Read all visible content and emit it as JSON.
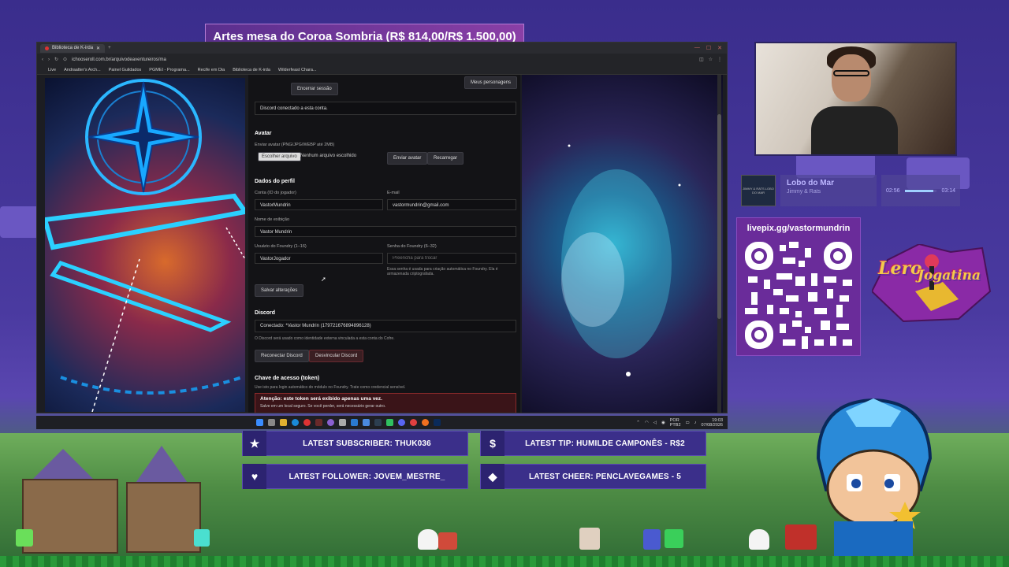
{
  "stream_title": "Artes mesa do Coroa Sombria (R$ 814,00/R$ 1.500,00)",
  "browser": {
    "tab_title": "Biblioteca de K-irda",
    "url": "ichooseroll.com.br/arquivodeaventureiros/ma",
    "bookmarks": [
      "Live",
      "Andraatter's Arch...",
      "Painel Guildados",
      "PGMEI - Programa...",
      "Recife em Dia",
      "Biblioteca de K-irda",
      "Wilderfeast Chara..."
    ]
  },
  "panel": {
    "my_characters_button": "Meus personagens",
    "logout_button": "Encerrar sessão",
    "discord_notice": "Discord conectado a esta conta.",
    "avatar": {
      "heading": "Avatar",
      "hint": "Enviar avatar (PNG/JPG/WEBP até 2MB)",
      "choose_file_button": "Escolher arquivo",
      "no_file_text": "Nenhum arquivo escolhido",
      "send_button": "Enviar avatar",
      "reload_button": "Recarregar"
    },
    "profile": {
      "heading": "Dados do perfil",
      "account_label": "Conta (ID do jogador)",
      "account_value": "VastorMundrin",
      "email_label": "E-mail",
      "email_value": "vastormundrin@gmail.com",
      "display_name_label": "Nome de exibição",
      "display_name_value": "Vastor Mundrin",
      "foundry_user_label": "Usuário do Foundry (1–16)",
      "foundry_user_value": "VastorJogador",
      "foundry_password_label": "Senha do Foundry (6–32)",
      "foundry_password_placeholder": "Preencha para trocar",
      "foundry_password_help": "Essa senha é usada para criação automática no Foundry. Ela é armazenada criptografada.",
      "save_button": "Salvar alterações"
    },
    "discord": {
      "heading": "Discord",
      "connected_text": "Conectado: *Vastor Mundrin (179721676894896128)",
      "help": "O Discord será usado como identidade externa vinculada a esta conta do Cofre.",
      "reconnect_button": "Reconectar Discord",
      "unlink_button": "Desvincular Discord"
    },
    "token": {
      "heading": "Chave de acesso (token)",
      "help": "Use isto para login automático do módulo no Foundry. Trate como credencial sensível.",
      "warning_title": "Atenção: este token será exibido apenas uma vez.",
      "warning_text": "Salve em um local seguro. Se você perder, será necessário gerar outro."
    }
  },
  "taskbar": {
    "lang": "POR",
    "lang_sub": "PTB2",
    "time": "19:03",
    "date": "07/08/2026"
  },
  "music": {
    "cover_text": "JIMMY & RATS LOBO DO MAR",
    "title": "Lobo do Mar",
    "artist": "Jimmy & Rats",
    "elapsed": "02:56",
    "total": "03:14",
    "progress": 0.9
  },
  "qr": {
    "url": "livepix.gg/vastormundrin"
  },
  "logo": {
    "line1": "Lero",
    "line2": "Jogatina"
  },
  "alerts": {
    "subscriber": "LATEST SUBSCRIBER: THUK036",
    "tip": "LATEST TIP: HUMILDE CAMPONÊS - R$2",
    "follower": "LATEST FOLLOWER: JOVEM_MESTRE_",
    "cheer": "LATEST CHEER: PENCLAVEGAMES - 5"
  },
  "colors": {
    "overlay_purple": "#3b2f86",
    "alert_bg": "#3b2f8a",
    "qr_card": "#6a2c9a",
    "warning_red": "#8a2a2a"
  }
}
